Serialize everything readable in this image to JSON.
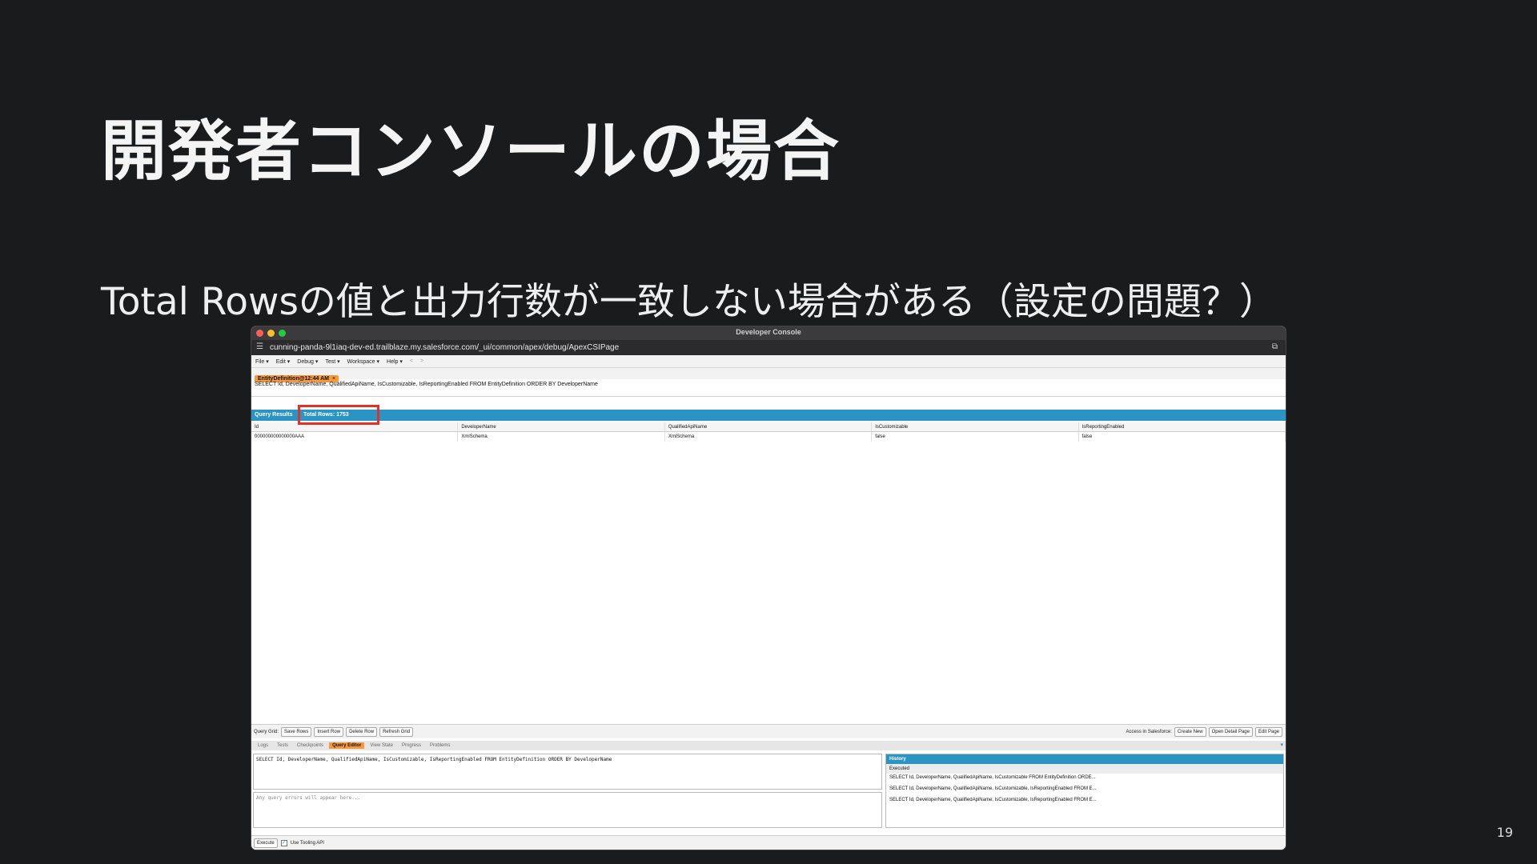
{
  "slide": {
    "title": "開発者コンソールの場合",
    "subtitle": "Total Rowsの値と出力行数が一致しない場合がある（設定の問題？）",
    "page_number": "19"
  },
  "window": {
    "title": "Developer Console",
    "url": "cunning-panda-9l1iaq-dev-ed.trailblaze.my.salesforce.com/_ui/common/apex/debug/ApexCSIPage"
  },
  "menu": {
    "items": [
      "File ▾",
      "Edit ▾",
      "Debug ▾",
      "Test ▾",
      "Workspace ▾",
      "Help ▾"
    ],
    "back": "<",
    "forward": ">"
  },
  "file_tab": {
    "label": "EntityDefinition@12:44 AM",
    "close": "×"
  },
  "query": {
    "text": "SELECT Id, DeveloperName, QualifiedApiName, IsCustomizable, IsReportingEnabled FROM EntityDefinition ORDER BY DeveloperName"
  },
  "results": {
    "title": "Query Results",
    "total_rows": "Total Rows: 1753",
    "columns": [
      "Id",
      "DeveloperName",
      "QualifiedApiName",
      "IsCustomizable",
      "IsReportingEnabled"
    ],
    "row": [
      "000000000000000AAA",
      "XmlSchema",
      "XmlSchema",
      "false",
      "false"
    ]
  },
  "query_grid": {
    "label": "Query Grid:",
    "buttons": [
      "Save Rows",
      "Insert Row",
      "Delete Row",
      "Refresh Grid"
    ],
    "access_label": "Access in Salesforce:",
    "access_buttons": [
      "Create New",
      "Open Detail Page",
      "Edit Page"
    ]
  },
  "bottom_tabs": [
    "Logs",
    "Tests",
    "Checkpoints",
    "Query Editor",
    "View State",
    "Progress",
    "Problems"
  ],
  "editor": {
    "text": "SELECT Id, DeveloperName, QualifiedApiName, IsCustomizable, IsReportingEnabled FROM EntityDefinition ORDER BY DeveloperName",
    "errors_placeholder": "Any query errors will appear here..."
  },
  "history": {
    "title": "History",
    "subtitle": "Executed",
    "items": [
      "SELECT Id, DeveloperName, QualifiedApiName, IsCustomizable FROM EntityDefinition ORDE...",
      "SELECT Id, DeveloperName, QualifiedApiName, IsCustomizable, IsReportingEnabled FROM E...",
      "SELECT Id, DeveloperName, QualifiedApiName, IsCustomizable, IsReportingEnabled FROM E..."
    ]
  },
  "execute": {
    "button": "Execute",
    "checkbox_label": "Use Tooling API",
    "checked": true
  }
}
